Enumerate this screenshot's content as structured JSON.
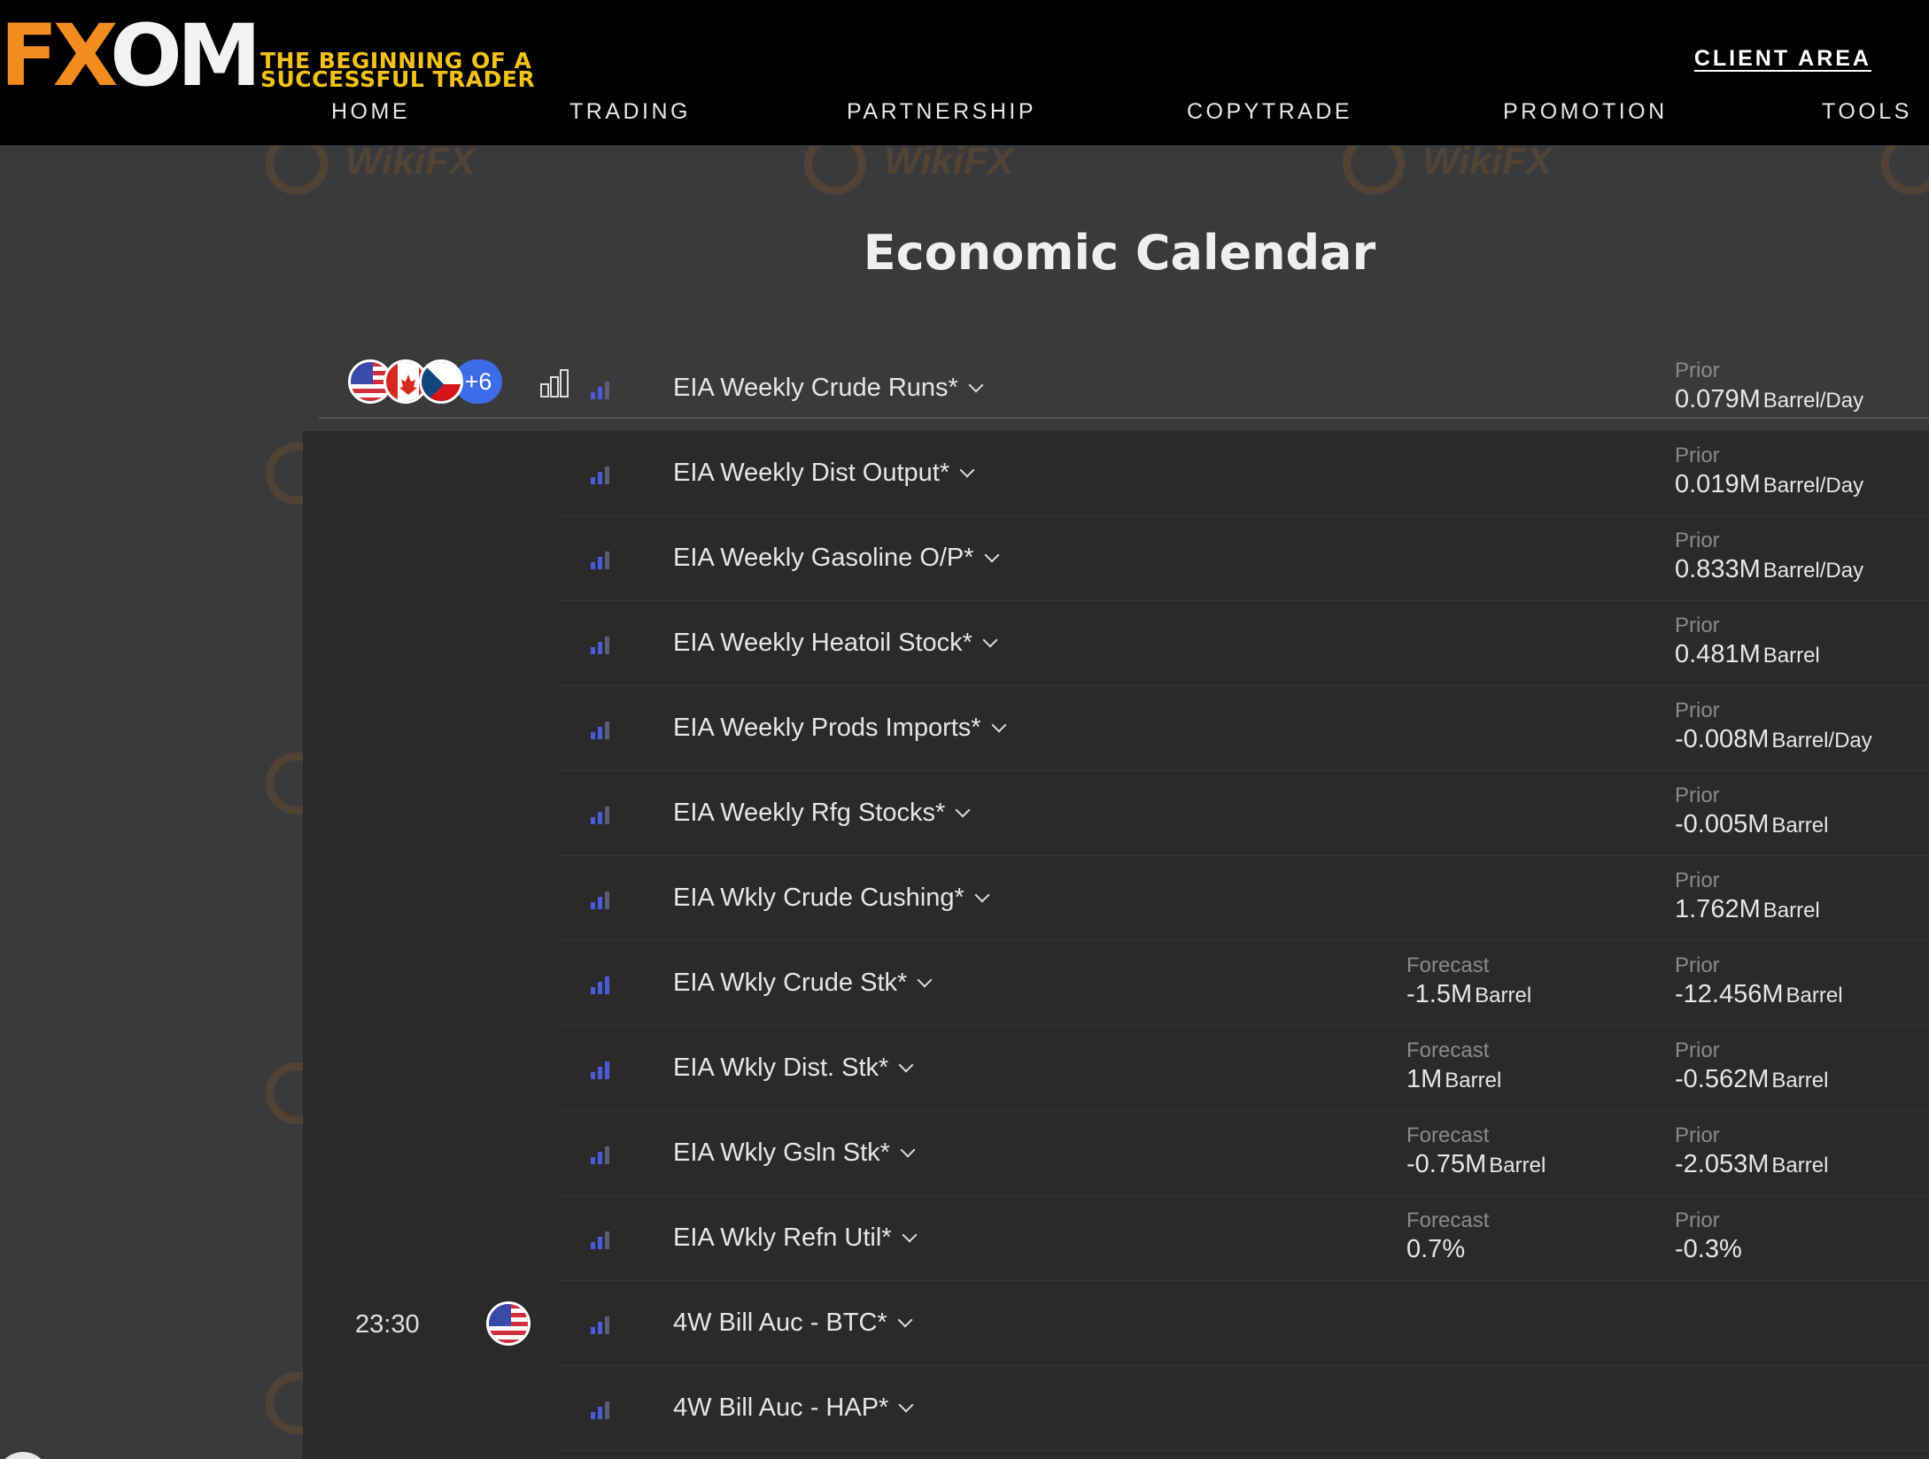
{
  "brand": {
    "logo_fx": "FX",
    "logo_om": "OM",
    "tagline_line1": "THE BEGINNING OF A",
    "tagline_line2": "SUCCESSFUL TRADER"
  },
  "header": {
    "client_area": "CLIENT AREA"
  },
  "nav": {
    "home": "HOME",
    "trading": "TRADING",
    "partnership": "PARTNERSHIP",
    "copytrade": "COPYTRADE",
    "promotion": "PROMOTION",
    "tools": "TOOLS"
  },
  "page": {
    "title": "Economic Calendar"
  },
  "filter": {
    "more_countries": "+6"
  },
  "watermark": "WikiFX",
  "colors": {
    "accent_orange": "#f28c1f",
    "tagline_yellow": "#f3c21a",
    "importance_blue": "#4a5bd9",
    "panel_bg": "#2a2a2b",
    "page_bg": "#3a3a3c"
  },
  "events": [
    {
      "name": "EIA Weekly Crude Runs*",
      "importance": 2,
      "forecast_label": "",
      "forecast": "",
      "forecast_unit": "",
      "prior_label": "Prior",
      "prior": "0.079M",
      "prior_unit": "Barrel/Day"
    },
    {
      "name": "EIA Weekly Dist Output*",
      "importance": 2,
      "forecast_label": "",
      "forecast": "",
      "forecast_unit": "",
      "prior_label": "Prior",
      "prior": "0.019M",
      "prior_unit": "Barrel/Day"
    },
    {
      "name": "EIA Weekly Gasoline O/P*",
      "importance": 2,
      "forecast_label": "",
      "forecast": "",
      "forecast_unit": "",
      "prior_label": "Prior",
      "prior": "0.833M",
      "prior_unit": "Barrel/Day"
    },
    {
      "name": "EIA Weekly Heatoil Stock*",
      "importance": 2,
      "forecast_label": "",
      "forecast": "",
      "forecast_unit": "",
      "prior_label": "Prior",
      "prior": "0.481M",
      "prior_unit": "Barrel"
    },
    {
      "name": "EIA Weekly Prods Imports*",
      "importance": 2,
      "forecast_label": "",
      "forecast": "",
      "forecast_unit": "",
      "prior_label": "Prior",
      "prior": "-0.008M",
      "prior_unit": "Barrel/Day"
    },
    {
      "name": "EIA Weekly Rfg Stocks*",
      "importance": 2,
      "forecast_label": "",
      "forecast": "",
      "forecast_unit": "",
      "prior_label": "Prior",
      "prior": "-0.005M",
      "prior_unit": "Barrel"
    },
    {
      "name": "EIA Wkly Crude Cushing*",
      "importance": 2,
      "forecast_label": "",
      "forecast": "",
      "forecast_unit": "",
      "prior_label": "Prior",
      "prior": "1.762M",
      "prior_unit": "Barrel"
    },
    {
      "name": "EIA Wkly Crude Stk*",
      "importance": 3,
      "forecast_label": "Forecast",
      "forecast": "-1.5M",
      "forecast_unit": "Barrel",
      "prior_label": "Prior",
      "prior": "-12.456M",
      "prior_unit": "Barrel"
    },
    {
      "name": "EIA Wkly Dist. Stk*",
      "importance": 3,
      "forecast_label": "Forecast",
      "forecast": "1M",
      "forecast_unit": "Barrel",
      "prior_label": "Prior",
      "prior": "-0.562M",
      "prior_unit": "Barrel"
    },
    {
      "name": "EIA Wkly Gsln Stk*",
      "importance": 2,
      "forecast_label": "Forecast",
      "forecast": "-0.75M",
      "forecast_unit": "Barrel",
      "prior_label": "Prior",
      "prior": "-2.053M",
      "prior_unit": "Barrel"
    },
    {
      "name": "EIA Wkly Refn Util*",
      "importance": 2,
      "forecast_label": "Forecast",
      "forecast": "0.7%",
      "forecast_unit": "",
      "prior_label": "Prior",
      "prior": "-0.3%",
      "prior_unit": ""
    },
    {
      "time": "23:30",
      "name": "4W Bill Auc - BTC*",
      "importance": 2,
      "forecast_label": "",
      "forecast": "",
      "forecast_unit": "",
      "prior_label": "",
      "prior": "",
      "prior_unit": ""
    },
    {
      "name": "4W Bill Auc - HAP*",
      "importance": 2,
      "forecast_label": "",
      "forecast": "",
      "forecast_unit": "",
      "prior_label": "",
      "prior": "",
      "prior_unit": ""
    }
  ]
}
